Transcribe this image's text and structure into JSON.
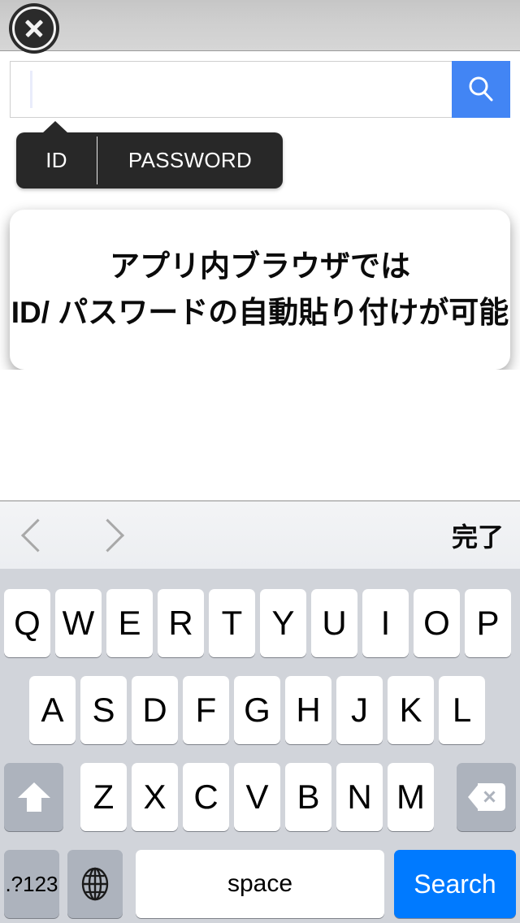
{
  "topbar": {
    "close_label": "close-overlay"
  },
  "search": {
    "value": "",
    "placeholder": "",
    "submit_label": "search",
    "submit_color": "#4285f4"
  },
  "credential_popup": {
    "id_label": "ID",
    "password_label": "PASSWORD",
    "background": "#282828"
  },
  "info_card": {
    "line1": "アプリ内ブラウザでは",
    "line2": "ID/ パスワードの自動貼り付けが可能"
  },
  "accessory_bar": {
    "prev_label": "previous-field",
    "next_label": "next-field",
    "done_label": "完了"
  },
  "keyboard": {
    "layout": "qwerty-uppercase",
    "row1": [
      "Q",
      "W",
      "E",
      "R",
      "T",
      "Y",
      "U",
      "I",
      "O",
      "P"
    ],
    "row2": [
      "A",
      "S",
      "D",
      "F",
      "G",
      "H",
      "J",
      "K",
      "L"
    ],
    "row3": [
      "Z",
      "X",
      "C",
      "V",
      "B",
      "N",
      "M"
    ],
    "shift_label": "shift",
    "backspace_label": "delete",
    "numeric_label": ".?123",
    "globe_label": "next-keyboard",
    "space_label": "space",
    "return_label": "Search",
    "return_color": "#007aff",
    "background": "#d1d4da"
  }
}
